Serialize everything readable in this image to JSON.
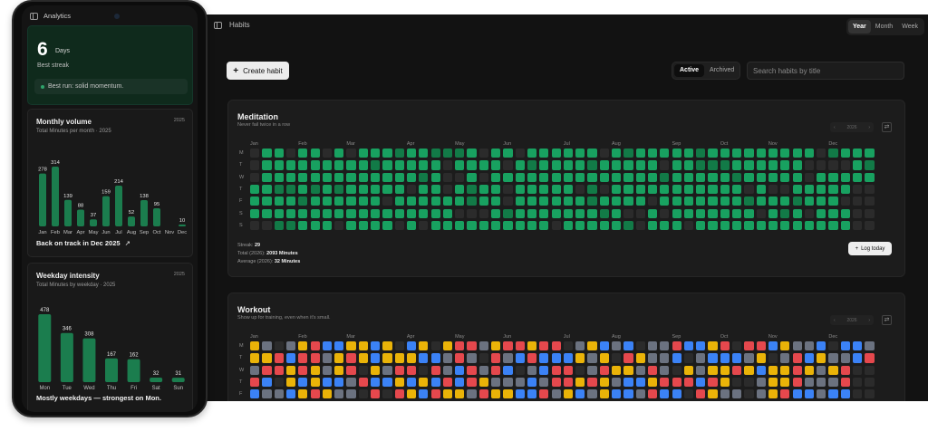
{
  "desktop": {
    "title": "Habits",
    "range_tabs": [
      "Year",
      "Month",
      "Week"
    ],
    "active_range": "Year",
    "create_label": "Create habit",
    "filters": [
      "Active",
      "Archived"
    ],
    "active_filter": "Active",
    "search_placeholder": "Search habits by title",
    "accent": "#18a160",
    "habits": [
      {
        "name": "Meditation",
        "description": "Never fail twice in a row",
        "year": "2026",
        "months": [
          "Jan",
          "Feb",
          "Mar",
          "Apr",
          "May",
          "Jun",
          "Jul",
          "Aug",
          "Sep",
          "Oct",
          "Nov",
          "Dec"
        ],
        "days": [
          "M",
          "T",
          "W",
          "T",
          "F",
          "S",
          "S"
        ],
        "streak_label": "Streak:",
        "streak_value": "29",
        "total_label": "Total (2026):",
        "total_value": "2093 Minutes",
        "average_label": "Average (2026):",
        "average_value": "32 Minutes",
        "log_label": "Log today"
      },
      {
        "name": "Workout",
        "description": "Show up for training, even when it's small.",
        "year": "2026",
        "months": [
          "Jan",
          "Feb",
          "Mar",
          "Apr",
          "May",
          "Jun",
          "Jul",
          "Aug",
          "Sep",
          "Oct",
          "Nov",
          "Dec"
        ],
        "days": [
          "M",
          "T",
          "W",
          "T",
          "F"
        ],
        "colors": [
          "#e5484d",
          "#3b82f6",
          "#eab308",
          "#6b7280"
        ]
      }
    ]
  },
  "phone": {
    "title": "Analytics",
    "best_streak": {
      "value": "6",
      "unit": "Days",
      "label": "Best streak",
      "note": "Best run: solid momentum."
    },
    "monthly": {
      "title": "Monthly volume",
      "subtitle": "Total Minutes per month · 2025",
      "year": "2025",
      "footer": "Back on track in Dec 2025"
    },
    "weekday": {
      "title": "Weekday intensity",
      "subtitle": "Total Minutes by weekday · 2025",
      "year": "2025",
      "footer": "Mostly weekdays — strongest on Mon."
    }
  },
  "chart_data": [
    {
      "type": "bar",
      "title": "Monthly volume",
      "categories": [
        "Jan",
        "Feb",
        "Mar",
        "Apr",
        "May",
        "Jun",
        "Jul",
        "Aug",
        "Sep",
        "Oct",
        "Nov",
        "Dec"
      ],
      "values": [
        278,
        314,
        139,
        88,
        37,
        159,
        214,
        52,
        138,
        95,
        0,
        10
      ],
      "color": "#1b7d4e"
    },
    {
      "type": "bar",
      "title": "Weekday intensity",
      "categories": [
        "Mon",
        "Tue",
        "Wed",
        "Thu",
        "Fri",
        "Sat",
        "Sun"
      ],
      "values": [
        478,
        346,
        308,
        167,
        162,
        32,
        31
      ],
      "color": "#1b7d4e"
    }
  ]
}
